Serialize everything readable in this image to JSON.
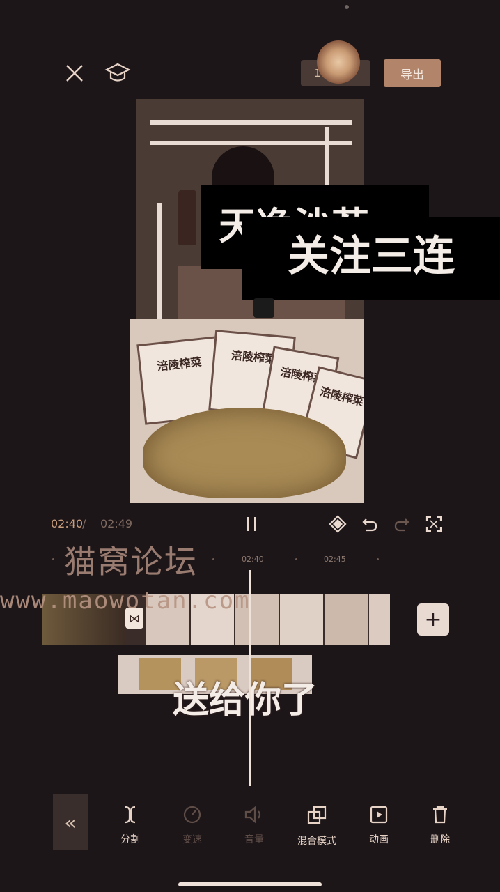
{
  "topbar": {
    "resolution_label": "1080P",
    "export_label": "导出"
  },
  "preview": {
    "caption_1": "天净沙茬",
    "caption_2": "关注三连",
    "pack_label": "涪陵榨菜"
  },
  "playback": {
    "current_time": "02:40",
    "separator": "/",
    "total_time": "02:49"
  },
  "ruler": {
    "ticks": [
      "02:40",
      "02:45"
    ]
  },
  "watermark": {
    "title": "猫窝论坛",
    "url": "www.maowotan.com"
  },
  "timeline": {
    "sticker_caption": "送给你了",
    "add_label": "+"
  },
  "toolbar": {
    "collapse_label": "«",
    "items": [
      {
        "label": "分割",
        "icon": "split-icon",
        "enabled": true
      },
      {
        "label": "变速",
        "icon": "speed-icon",
        "enabled": false
      },
      {
        "label": "音量",
        "icon": "volume-icon",
        "enabled": false
      },
      {
        "label": "混合模式",
        "icon": "blend-mode-icon",
        "enabled": true
      },
      {
        "label": "动画",
        "icon": "animation-icon",
        "enabled": true
      },
      {
        "label": "删除",
        "icon": "delete-icon",
        "enabled": true
      }
    ]
  },
  "colors": {
    "background": "#1d1619",
    "accent": "#b2856b",
    "text": "#e9d9cf"
  }
}
